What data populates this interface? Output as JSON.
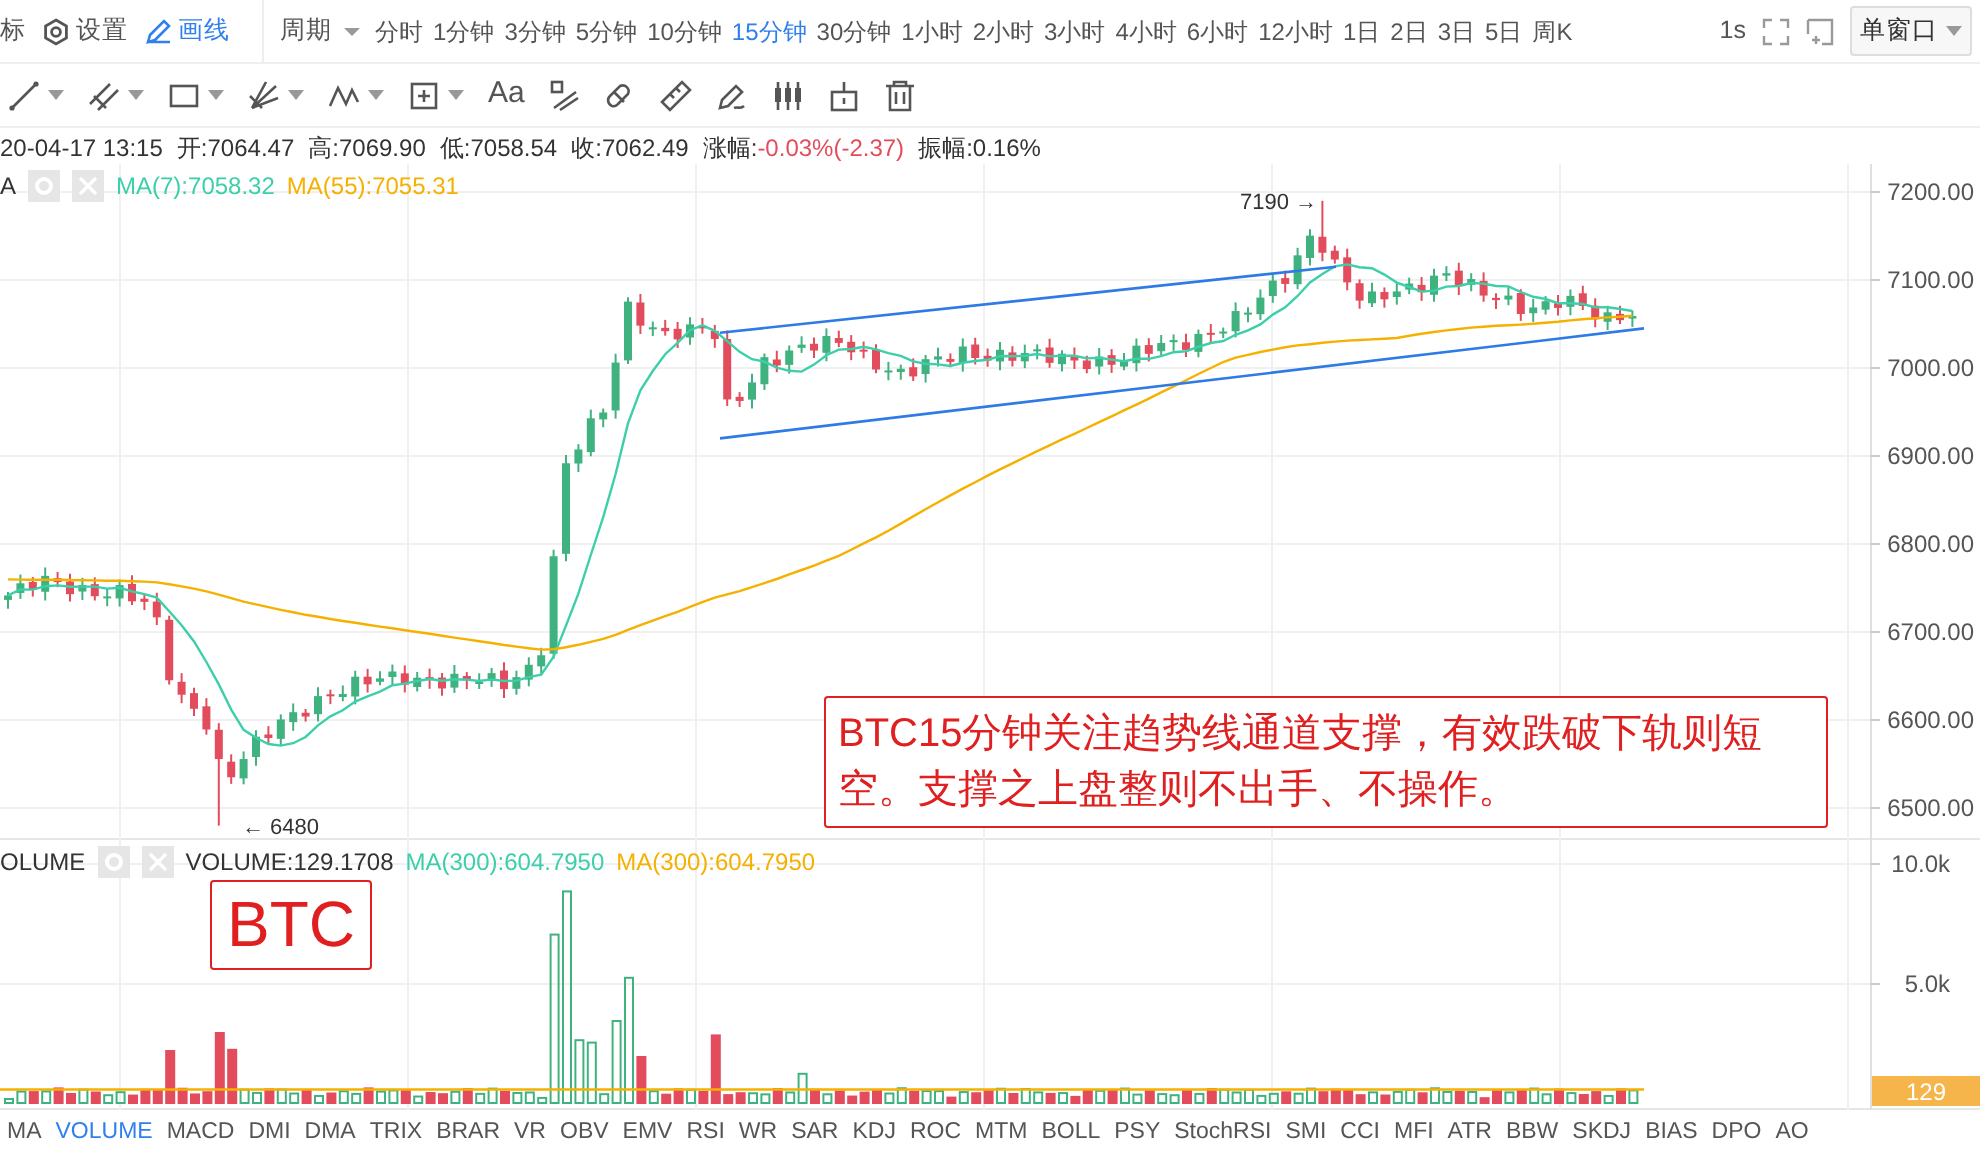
{
  "toolbar": {
    "items": [
      {
        "kind": "text",
        "label": "标"
      },
      {
        "kind": "settings",
        "label": "设置"
      },
      {
        "kind": "draw",
        "label": "画线"
      }
    ],
    "period_label": "周期",
    "intervals": [
      {
        "label": "分时",
        "selected": false
      },
      {
        "label": "1分钟",
        "selected": false
      },
      {
        "label": "3分钟",
        "selected": false
      },
      {
        "label": "5分钟",
        "selected": false
      },
      {
        "label": "10分钟",
        "selected": false
      },
      {
        "label": "15分钟",
        "selected": true
      },
      {
        "label": "30分钟",
        "selected": false
      },
      {
        "label": "1小时",
        "selected": false
      },
      {
        "label": "2小时",
        "selected": false
      },
      {
        "label": "3小时",
        "selected": false
      },
      {
        "label": "4小时",
        "selected": false
      },
      {
        "label": "6小时",
        "selected": false
      },
      {
        "label": "12小时",
        "selected": false
      },
      {
        "label": "1日",
        "selected": false
      },
      {
        "label": "2日",
        "selected": false
      },
      {
        "label": "3日",
        "selected": false
      },
      {
        "label": "5日",
        "selected": false
      },
      {
        "label": "周K",
        "selected": false
      }
    ],
    "refresh": "1s",
    "window_mode": "单窗口"
  },
  "drawing_tools": {
    "text_tool": "Aa"
  },
  "info_bar": {
    "time": "20-04-17 13:15",
    "fields": [
      {
        "label": "开:",
        "value": "7064.47"
      },
      {
        "label": "高:",
        "value": "7069.90"
      },
      {
        "label": "低:",
        "value": "7058.54"
      },
      {
        "label": "收:",
        "value": "7062.49"
      },
      {
        "label": "涨幅:",
        "value": "-0.03%(-2.37)",
        "color": "#e24c5c"
      },
      {
        "label": "振幅:",
        "value": "0.16%"
      }
    ]
  },
  "price_pane": {
    "legend": {
      "name": "A",
      "series": [
        {
          "label": "MA(7):7058.32",
          "color": "#3ccfaa"
        },
        {
          "label": "MA(55):7055.31",
          "color": "#f5b100"
        }
      ]
    },
    "axis_labels": [
      "7200.00",
      "7100.00",
      "7000.00",
      "6900.00",
      "6800.00",
      "6700.00",
      "6600.00",
      "6500.00"
    ],
    "annotations": {
      "high": "7190 →",
      "low": "← 6480"
    },
    "note": "BTC15分钟关注趋势线通道支撑，有效跌破下轨则短空。支撑之上盘整则不出手、不操作。"
  },
  "volume_pane": {
    "legend": {
      "name": "OLUME",
      "series": [
        {
          "label": "VOLUME:129.1708",
          "color": "#333333"
        },
        {
          "label": "MA(300):604.7950",
          "color": "#3ccfaa"
        },
        {
          "label": "MA(300):604.7950",
          "color": "#f5b100"
        }
      ]
    },
    "axis_labels": [
      "10.0k",
      "5.0k"
    ],
    "last_value": "129",
    "note": "BTC"
  },
  "indicator_tabs": [
    {
      "label": "MA",
      "selected": false
    },
    {
      "label": "VOLUME",
      "selected": true
    },
    {
      "label": "MACD",
      "selected": false
    },
    {
      "label": "DMI",
      "selected": false
    },
    {
      "label": "DMA",
      "selected": false
    },
    {
      "label": "TRIX",
      "selected": false
    },
    {
      "label": "BRAR",
      "selected": false
    },
    {
      "label": "VR",
      "selected": false
    },
    {
      "label": "OBV",
      "selected": false
    },
    {
      "label": "EMV",
      "selected": false
    },
    {
      "label": "RSI",
      "selected": false
    },
    {
      "label": "WR",
      "selected": false
    },
    {
      "label": "SAR",
      "selected": false
    },
    {
      "label": "KDJ",
      "selected": false
    },
    {
      "label": "ROC",
      "selected": false
    },
    {
      "label": "MTM",
      "selected": false
    },
    {
      "label": "BOLL",
      "selected": false
    },
    {
      "label": "PSY",
      "selected": false
    },
    {
      "label": "StochRSI",
      "selected": false
    },
    {
      "label": "SMI",
      "selected": false
    },
    {
      "label": "CCI",
      "selected": false
    },
    {
      "label": "MFI",
      "selected": false
    },
    {
      "label": "ATR",
      "selected": false
    },
    {
      "label": "BBW",
      "selected": false
    },
    {
      "label": "SKDJ",
      "selected": false
    },
    {
      "label": "BIAS",
      "selected": false
    },
    {
      "label": "DPO",
      "selected": false
    },
    {
      "label": "AO",
      "selected": false
    }
  ]
}
